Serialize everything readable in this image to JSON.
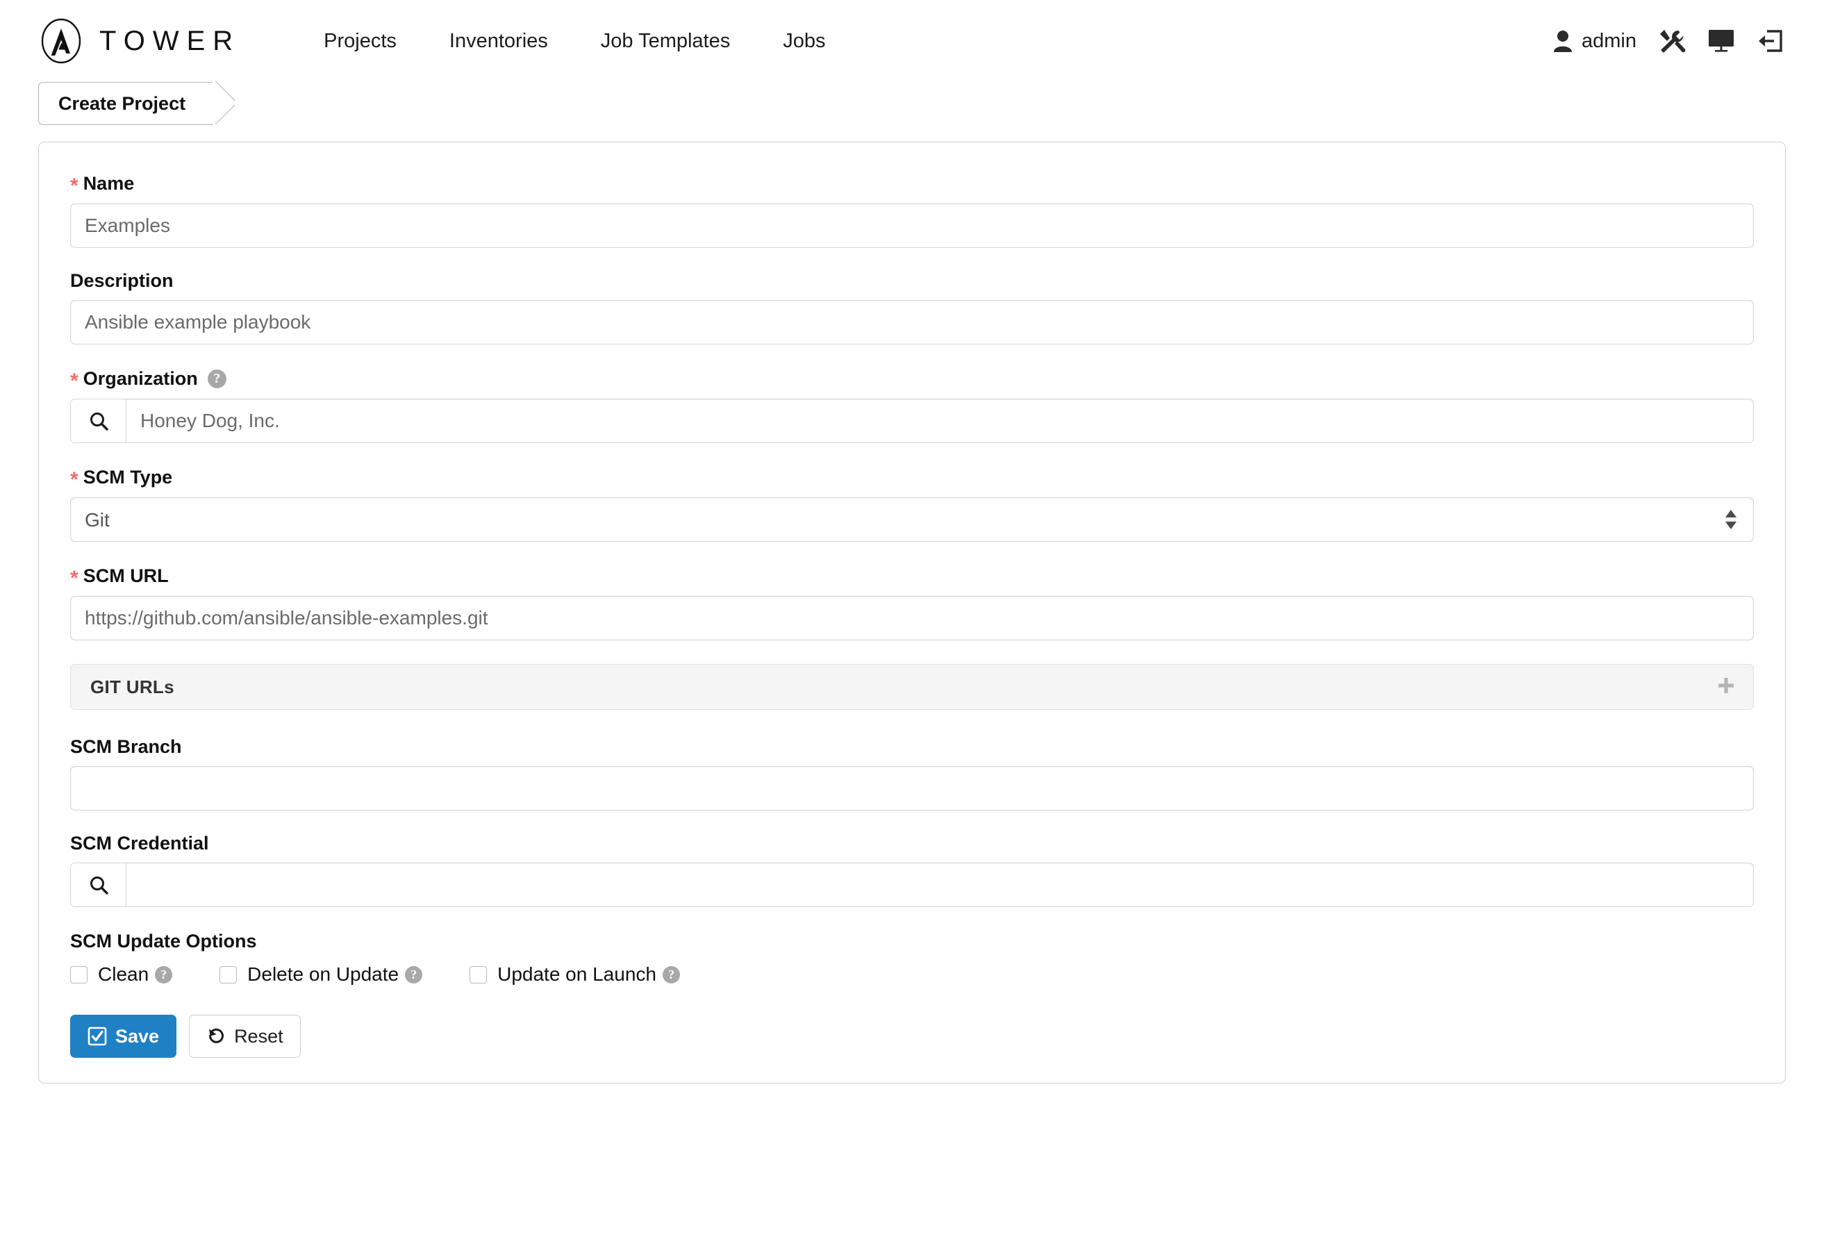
{
  "header": {
    "brand_name": "TOWER",
    "brand_icon": "ansible-logo-icon",
    "nav": [
      {
        "label": "Projects"
      },
      {
        "label": "Inventories"
      },
      {
        "label": "Job Templates"
      },
      {
        "label": "Jobs"
      }
    ],
    "user": {
      "name": "admin",
      "icon": "user-icon"
    },
    "actions": [
      {
        "icon": "tools-icon"
      },
      {
        "icon": "monitor-icon"
      },
      {
        "icon": "logout-icon"
      }
    ]
  },
  "breadcrumb": {
    "label": "Create Project"
  },
  "form": {
    "name": {
      "label": "Name",
      "required_marker": "*",
      "value": "Examples",
      "placeholder": "Examples"
    },
    "description": {
      "label": "Description",
      "value": "Ansible example playbook",
      "placeholder": "Ansible example playbook"
    },
    "organization": {
      "label": "Organization",
      "required_marker": "*",
      "help_icon": "question-circle-icon",
      "search_icon": "search-icon",
      "value": "Honey Dog, Inc.",
      "placeholder": "Honey Dog, Inc."
    },
    "scm_type": {
      "label": "SCM Type",
      "required_marker": "*",
      "value": "Git",
      "options": [
        "Git"
      ]
    },
    "scm_url": {
      "label": "SCM URL",
      "required_marker": "*",
      "value": "https://github.com/ansible/ansible-examples.git",
      "placeholder": "https://github.com/ansible/ansible-examples.git"
    },
    "git_urls_panel": {
      "title": "GIT URLs",
      "expand_icon": "plus-icon"
    },
    "scm_branch": {
      "label": "SCM Branch",
      "value": "",
      "placeholder": ""
    },
    "scm_credential": {
      "label": "SCM Credential",
      "search_icon": "search-icon",
      "value": "",
      "placeholder": ""
    },
    "scm_update_options": {
      "label": "SCM Update Options",
      "options": [
        {
          "label": "Clean",
          "checked": false,
          "help_icon": "question-circle-icon"
        },
        {
          "label": "Delete on Update",
          "checked": false,
          "help_icon": "question-circle-icon"
        },
        {
          "label": "Update on Launch",
          "checked": false,
          "help_icon": "question-circle-icon"
        }
      ]
    },
    "buttons": {
      "save": {
        "label": "Save",
        "icon": "check-square-icon"
      },
      "reset": {
        "label": "Reset",
        "icon": "undo-icon"
      }
    }
  },
  "colors": {
    "primary_button": "#2080c4",
    "required_asterisk": "#f66a6a",
    "panel_background": "#f5f5f5",
    "border": "#d4d4d4"
  }
}
